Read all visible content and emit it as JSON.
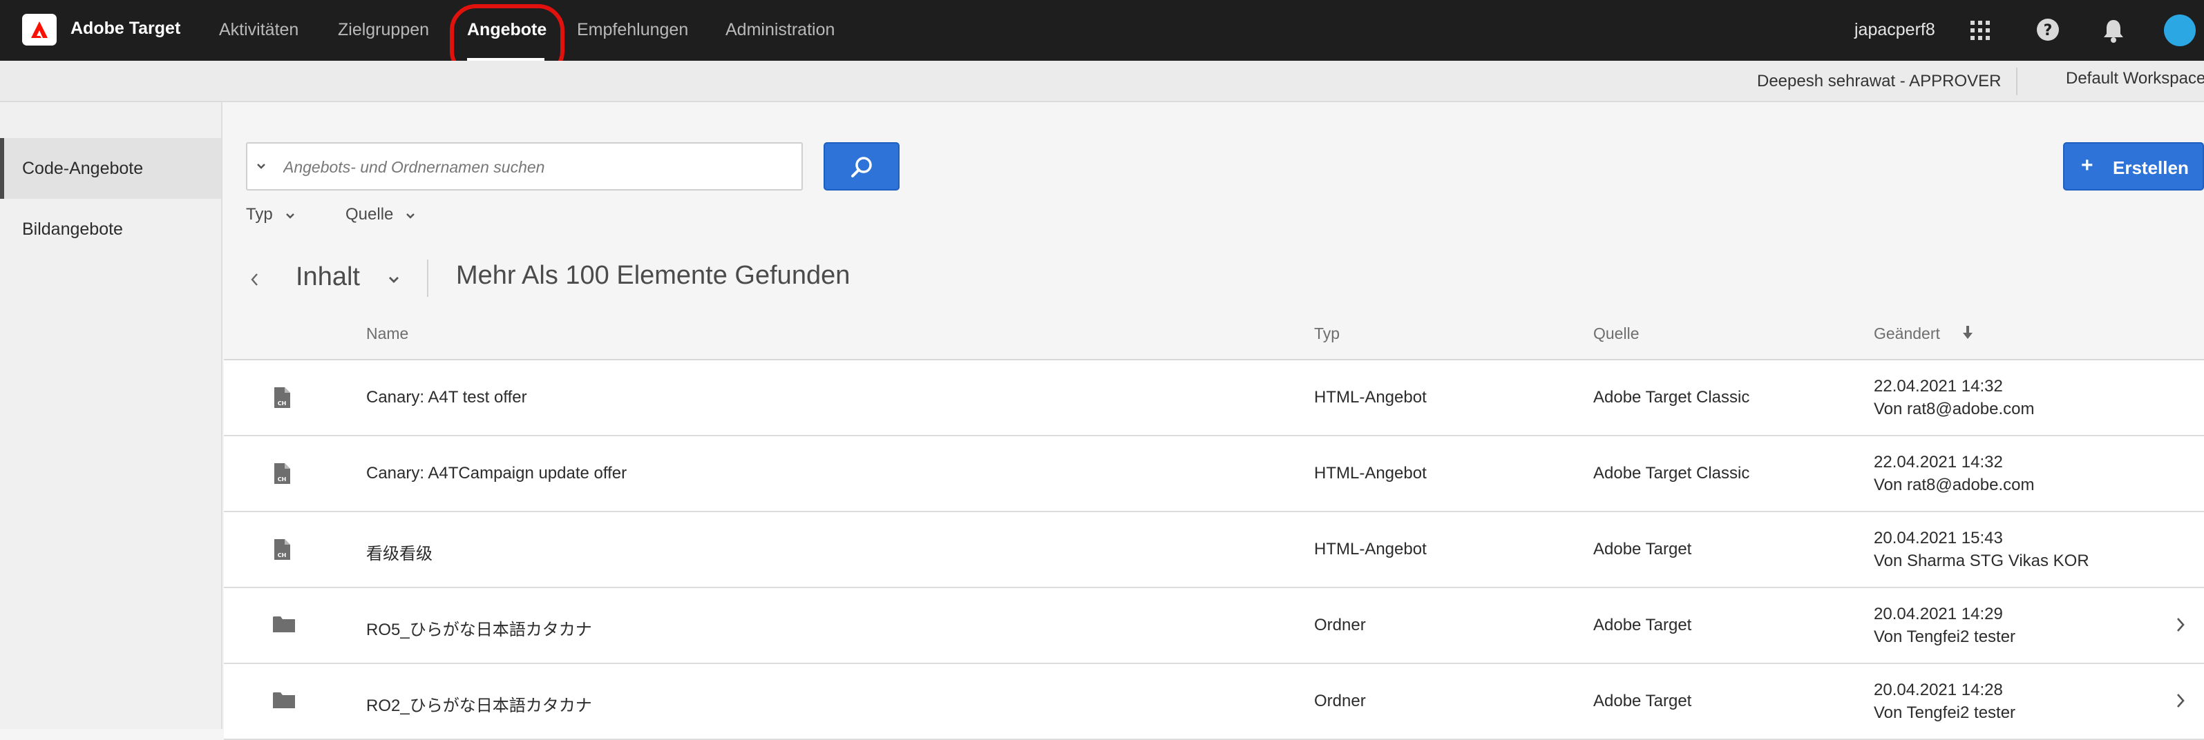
{
  "app": {
    "title": "Adobe Target",
    "logo_icon": "adobe-logo-icon",
    "brand_color": "#fa0f00"
  },
  "nav": {
    "items": [
      {
        "label": "Aktivitäten",
        "active": false
      },
      {
        "label": "Zielgruppen",
        "active": false
      },
      {
        "label": "Angebote",
        "active": true
      },
      {
        "label": "Empfehlungen",
        "active": false
      },
      {
        "label": "Administration",
        "active": false
      }
    ],
    "highlight_color": "#e1120e"
  },
  "topbar_right": {
    "user": "japacperf8",
    "icons": [
      "apps-grid-icon",
      "help-icon",
      "notification-bell-icon",
      "avatar"
    ]
  },
  "subheader": {
    "approver": "Deepesh sehrawat - APPROVER",
    "workspace": "Default Workspace"
  },
  "sidebar": {
    "items": [
      {
        "label": "Code-Angebote",
        "selected": true
      },
      {
        "label": "Bildangebote",
        "selected": false
      }
    ]
  },
  "search": {
    "placeholder": "Angebots- und Ordnernamen suchen",
    "value": "",
    "button_icon": "search-icon"
  },
  "create_button": {
    "label": "Erstellen",
    "icon": "plus-icon"
  },
  "filters": [
    {
      "label": "Typ"
    },
    {
      "label": "Quelle"
    }
  ],
  "content": {
    "label": "Inhalt",
    "count_text": "Mehr Als 100 Elemente Gefunden"
  },
  "table": {
    "columns": {
      "name": "Name",
      "type": "Typ",
      "source": "Quelle",
      "changed": "Geändert"
    },
    "sort": {
      "column": "Geändert",
      "direction": "descending"
    },
    "rows": [
      {
        "icon": "code-file-icon",
        "name": "Canary: A4T test offer",
        "type": "HTML-Angebot",
        "source": "Adobe Target Classic",
        "date": "22.04.2021  14:32",
        "by": "Von rat8@adobe.com",
        "has_chevron": false
      },
      {
        "icon": "code-file-icon",
        "name": "Canary: A4TCampaign update offer",
        "type": "HTML-Angebot",
        "source": "Adobe Target Classic",
        "date": "22.04.2021  14:32",
        "by": "Von rat8@adobe.com",
        "has_chevron": false
      },
      {
        "icon": "code-file-icon",
        "name": "看级看级",
        "type": "HTML-Angebot",
        "source": "Adobe Target",
        "date": "20.04.2021  15:43",
        "by": "Von Sharma STG Vikas KOR",
        "has_chevron": false
      },
      {
        "icon": "folder-icon",
        "name": "RO5_ひらがな日本語カタカナ",
        "type": "Ordner",
        "source": "Adobe Target",
        "date": "20.04.2021  14:29",
        "by": "Von Tengfei2 tester",
        "has_chevron": true
      },
      {
        "icon": "folder-icon",
        "name": "RO2_ひらがな日本語カタカナ",
        "type": "Ordner",
        "source": "Adobe Target",
        "date": "20.04.2021  14:28",
        "by": "Von Tengfei2 tester",
        "has_chevron": true
      }
    ]
  }
}
